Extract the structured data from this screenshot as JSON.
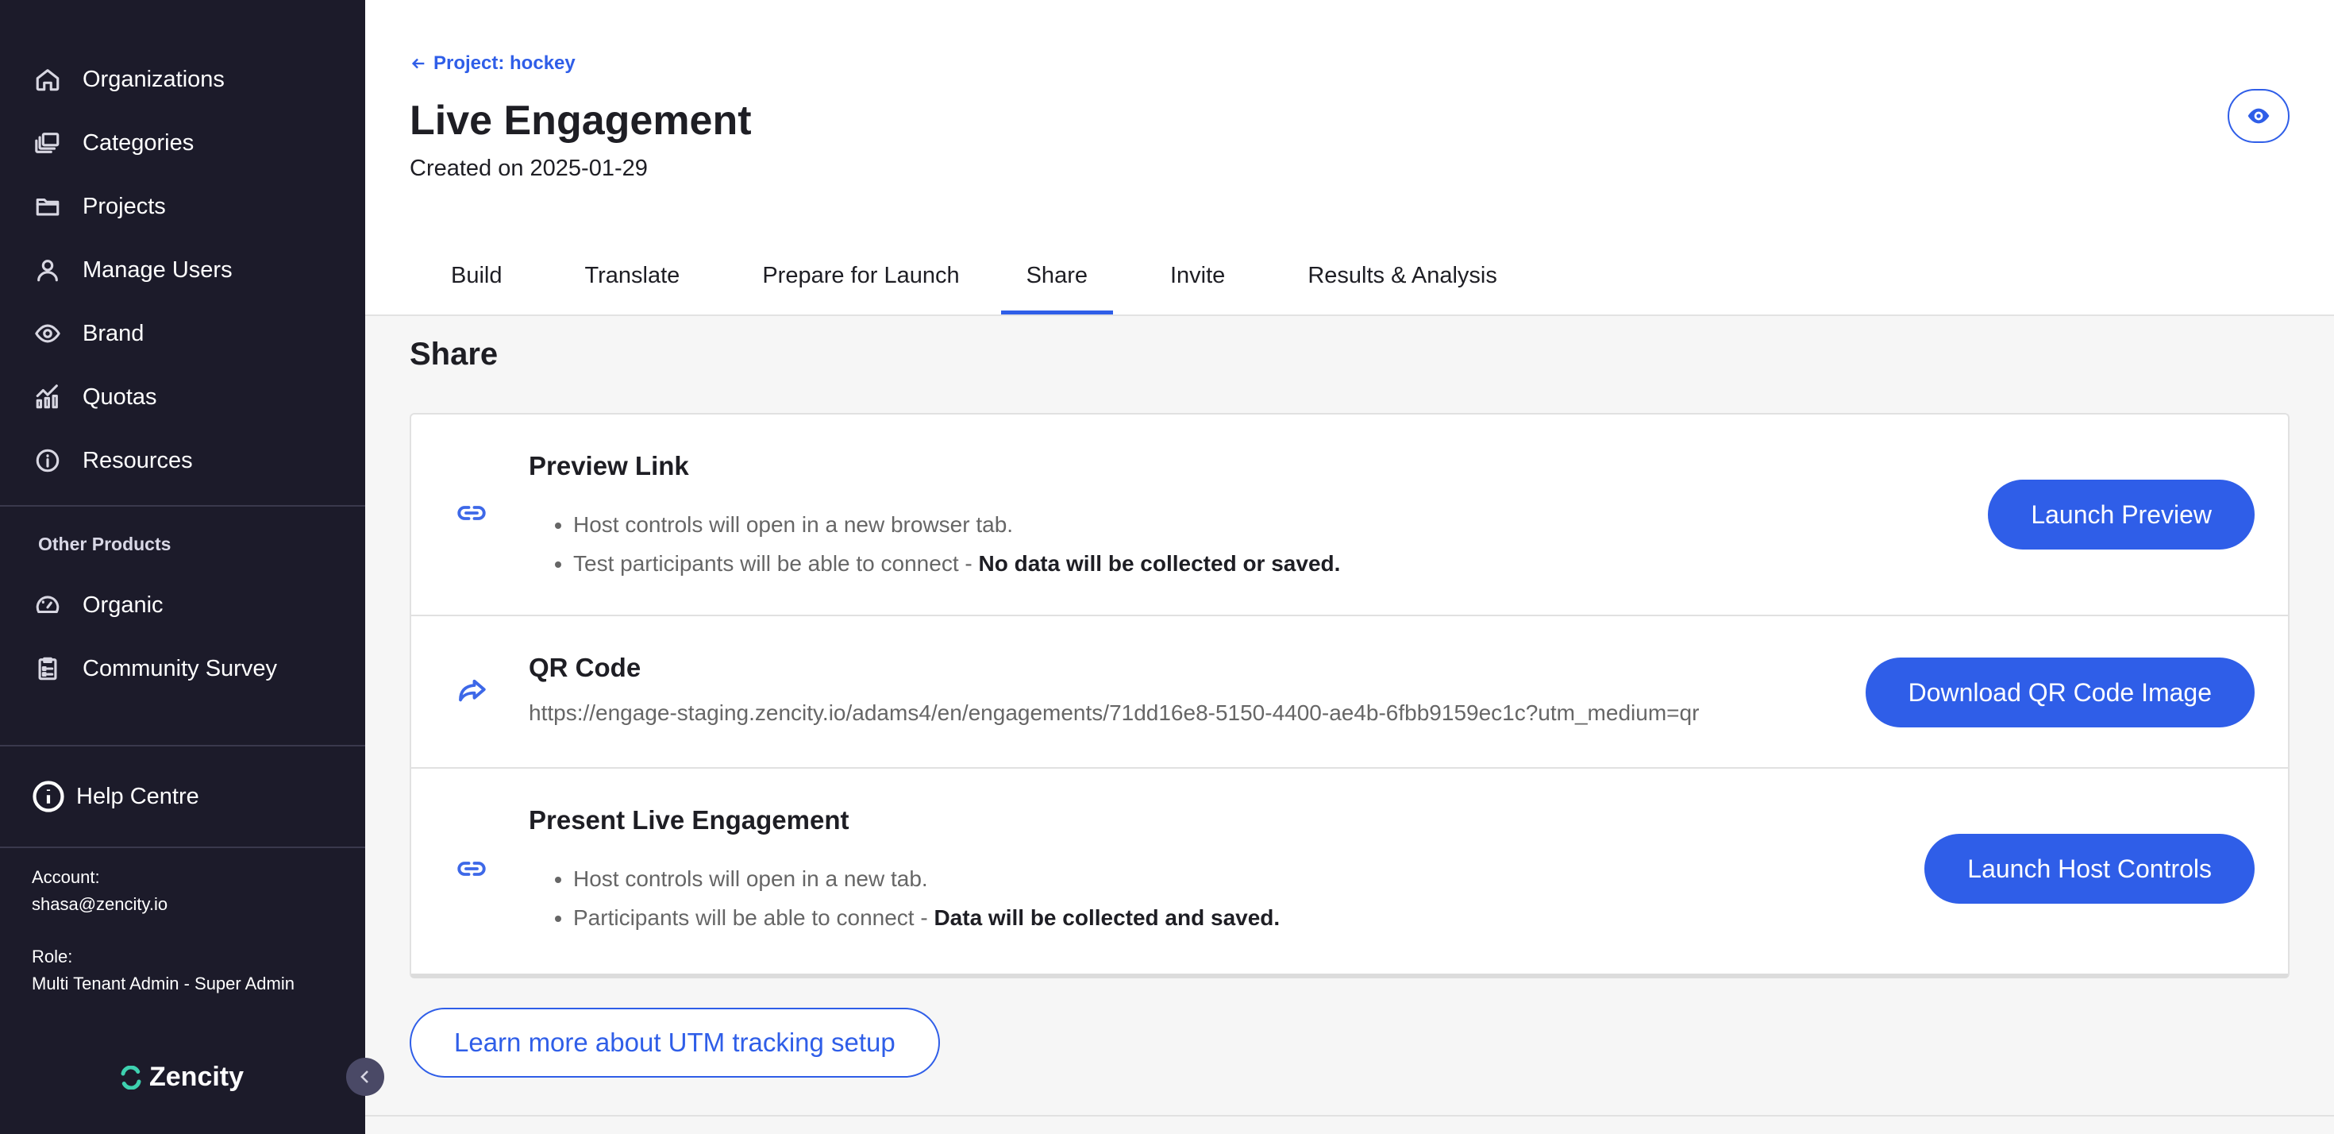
{
  "sidebar": {
    "nav": [
      {
        "label": "Organizations",
        "icon": "home-icon"
      },
      {
        "label": "Categories",
        "icon": "layers-icon"
      },
      {
        "label": "Projects",
        "icon": "folder-icon"
      },
      {
        "label": "Manage Users",
        "icon": "user-icon"
      },
      {
        "label": "Brand",
        "icon": "eye-icon"
      },
      {
        "label": "Quotas",
        "icon": "chart-icon"
      },
      {
        "label": "Resources",
        "icon": "info-icon"
      }
    ],
    "other_products_label": "Other Products",
    "other_products": [
      {
        "label": "Organic",
        "icon": "gauge-icon"
      },
      {
        "label": "Community Survey",
        "icon": "clipboard-icon"
      }
    ],
    "help_label": "Help Centre",
    "account_label": "Account:",
    "account_value": "shasa@zencity.io",
    "role_label": "Role:",
    "role_value": "Multi Tenant Admin - Super Admin",
    "logo_text": "Zencity"
  },
  "header": {
    "back_link": "Project: hockey",
    "title": "Live Engagement",
    "created": "Created on 2025-01-29",
    "tabs": [
      "Build",
      "Translate",
      "Prepare for Launch",
      "Share",
      "Invite",
      "Results & Analysis"
    ],
    "active_tab": "Share"
  },
  "share": {
    "title": "Share",
    "preview": {
      "title": "Preview Link",
      "bullet1": "Host controls will open in a new browser tab.",
      "bullet2_text": "Test participants will be able to connect - ",
      "bullet2_bold": "No data will be collected or saved.",
      "button": "Launch Preview"
    },
    "qr": {
      "title": "QR Code",
      "url": "https://engage-staging.zencity.io/adams4/en/engagements/71dd16e8-5150-4400-ae4b-6fbb9159ec1c?utm_medium=qr",
      "button": "Download QR Code Image"
    },
    "present": {
      "title": "Present Live Engagement",
      "bullet1": "Host controls will open in a new tab.",
      "bullet2_text": "Participants will be able to connect - ",
      "bullet2_bold": "Data will be collected and saved.",
      "button": "Launch Host Controls"
    },
    "utm_button": "Learn more about UTM tracking setup"
  },
  "colors": {
    "accent": "#2f5ee8",
    "sidebar_bg": "#1c1b2a"
  }
}
